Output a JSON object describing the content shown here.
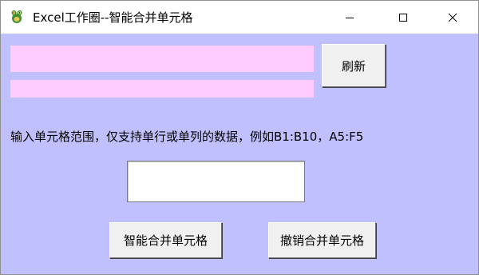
{
  "window": {
    "title": "Excel工作圈--智能合并单元格",
    "app_icon": "frog-icon"
  },
  "titlebar_buttons": {
    "minimize": "minimize-icon",
    "maximize": "maximize-icon",
    "close": "close-icon"
  },
  "status": {
    "line1": "",
    "line2": ""
  },
  "buttons": {
    "refresh_label": "刷新",
    "merge_label": "智能合并单元格",
    "undo_label": "撤销合并单元格"
  },
  "hint": {
    "text": "输入单元格范围，仅支持单行或单列的数据，例如B1:B10，A5:F5"
  },
  "range_input": {
    "value": "",
    "placeholder": ""
  },
  "colors": {
    "background": "#c0c0ff",
    "status_bar": "#ffccff",
    "button_face": "#f0f0f0"
  }
}
